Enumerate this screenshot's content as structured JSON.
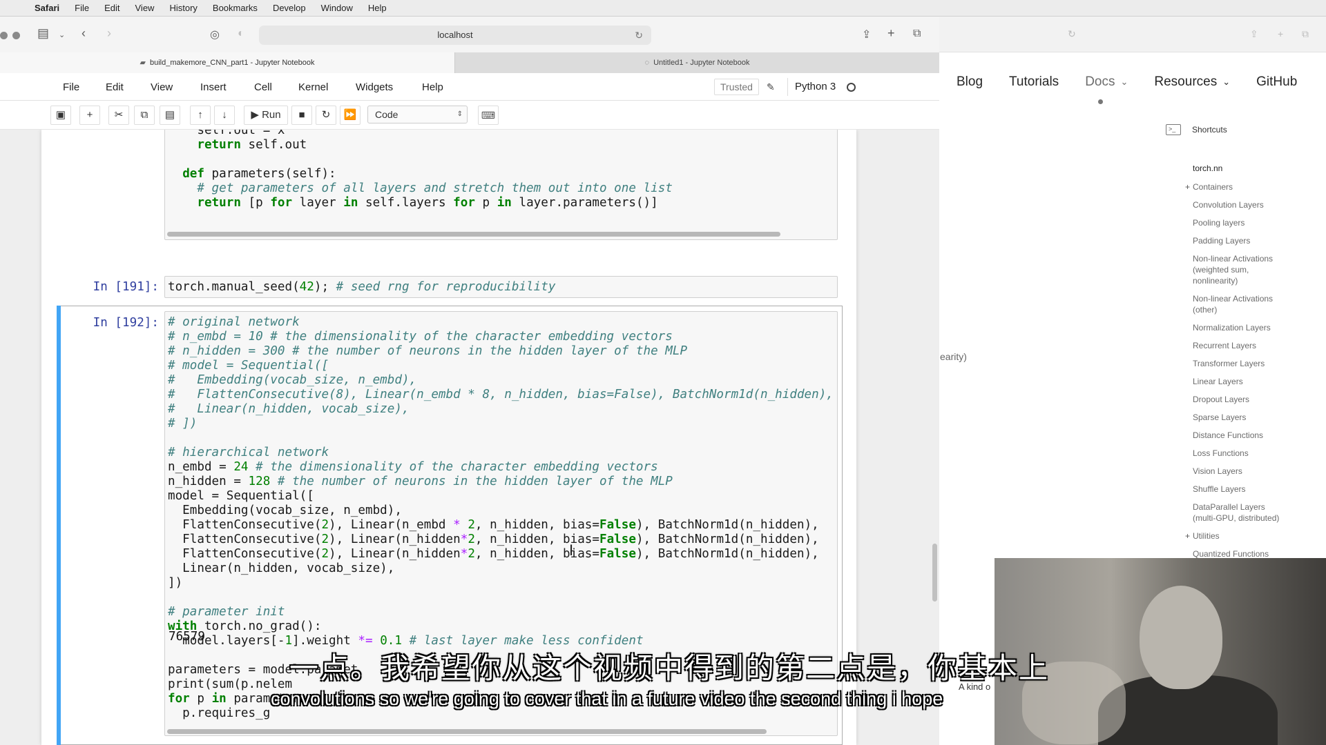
{
  "menubar": {
    "apple": "",
    "items": [
      "Safari",
      "File",
      "Edit",
      "View",
      "History",
      "Bookmarks",
      "Develop",
      "Window",
      "Help"
    ]
  },
  "browser": {
    "url": "localhost",
    "tabs": [
      {
        "title": "build_makemore_CNN_part1 - Jupyter Notebook",
        "active": true
      },
      {
        "title": "Untitled1 - Jupyter Notebook",
        "active": false
      }
    ]
  },
  "jupyter": {
    "menu": [
      "File",
      "Edit",
      "View",
      "Insert",
      "Cell",
      "Kernel",
      "Widgets",
      "Help"
    ],
    "trusted": "Trusted",
    "kernel": "Python 3",
    "run_label": "Run",
    "cell_type": "Code"
  },
  "cells": {
    "top_lines": [
      "    self.out = x",
      "    return self.out",
      "",
      "  def parameters(self):",
      "    # get parameters of all layers and stretch them out into one list",
      "    return [p for layer in self.layers for p in layer.parameters()]"
    ],
    "cell191_prompt": "In [191]:",
    "cell191_code": "torch.manual_seed(42); # seed rng for reproducibility",
    "cell192_prompt": "In [192]:",
    "cell192_lines": [
      "# original network",
      "# n_embd = 10 # the dimensionality of the character embedding vectors",
      "# n_hidden = 300 # the number of neurons in the hidden layer of the MLP",
      "# model = Sequential([",
      "#   Embedding(vocab_size, n_embd),",
      "#   FlattenConsecutive(8), Linear(n_embd * 8, n_hidden, bias=False), BatchNorm1d(n_hidden),",
      "#   Linear(n_hidden, vocab_size),",
      "# ])",
      "",
      "# hierarchical network",
      "n_embd = 24 # the dimensionality of the character embedding vectors",
      "n_hidden = 128 # the number of neurons in the hidden layer of the MLP",
      "model = Sequential([",
      "  Embedding(vocab_size, n_embd),",
      "  FlattenConsecutive(2), Linear(n_embd * 2, n_hidden, bias=False), BatchNorm1d(n_hidden),",
      "  FlattenConsecutive(2), Linear(n_hidden*2, n_hidden, bias=False), BatchNorm1d(n_hidden),",
      "  FlattenConsecutive(2), Linear(n_hidden*2, n_hidden, bias=False), BatchNorm1d(n_hidden),",
      "  Linear(n_hidden, vocab_size),",
      "])",
      "",
      "# parameter init",
      "with torch.no_grad():",
      "  model.layers[-1].weight *= 0.1 # last layer make less confident",
      "",
      "parameters = model.paramet",
      "print(sum(p.nelem",
      "for p in parameters:",
      "  p.requires_g"
    ],
    "output": "76579"
  },
  "docs": {
    "nav": [
      "Blog",
      "Tutorials",
      "Docs",
      "Resources",
      "GitHub"
    ],
    "shortcuts": "Shortcuts",
    "section": "torch.nn",
    "items": [
      {
        "label": "Containers",
        "plus": true
      },
      {
        "label": "Convolution Layers",
        "plus": false
      },
      {
        "label": "Pooling layers",
        "plus": false
      },
      {
        "label": "Padding Layers",
        "plus": false
      },
      {
        "label": "Non-linear Activations (weighted sum, nonlinearity)",
        "plus": false
      },
      {
        "label": "Non-linear Activations (other)",
        "plus": false
      },
      {
        "label": "Normalization Layers",
        "plus": false
      },
      {
        "label": "Recurrent Layers",
        "plus": false
      },
      {
        "label": "Transformer Layers",
        "plus": false
      },
      {
        "label": "Linear Layers",
        "plus": false
      },
      {
        "label": "Dropout Layers",
        "plus": false
      },
      {
        "label": "Sparse Layers",
        "plus": false
      },
      {
        "label": "Distance Functions",
        "plus": false
      },
      {
        "label": "Loss Functions",
        "plus": false
      },
      {
        "label": "Vision Layers",
        "plus": false
      },
      {
        "label": "Shuffle Layers",
        "plus": false
      },
      {
        "label": "DataParallel Layers (multi-GPU, distributed)",
        "plus": false
      },
      {
        "label": "Utilities",
        "plus": true
      },
      {
        "label": "Quantized Functions",
        "plus": false
      }
    ],
    "fragment_earity": "earity)",
    "fragment_akind": "A kind o"
  },
  "subtitles": {
    "chinese": "一点。我希望你从这个视频中得到的第二点是，你基本上",
    "english": "convolutions so we're going to cover that in a future video the second thing i hope"
  }
}
